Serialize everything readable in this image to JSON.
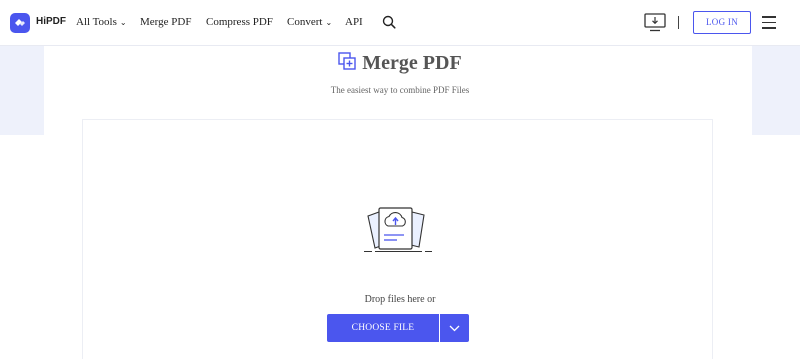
{
  "brand": {
    "name": "HiPDF",
    "logo_icon": "hipdf-logo-icon",
    "accent": "#4b56ee"
  },
  "nav": {
    "items": [
      {
        "label": "All Tools",
        "has_caret": true
      },
      {
        "label": "Merge PDF",
        "has_caret": false
      },
      {
        "label": "Compress PDF",
        "has_caret": false
      },
      {
        "label": "Convert",
        "has_caret": true
      },
      {
        "label": "API",
        "has_caret": false
      }
    ],
    "caret_glyph": "⌄",
    "search_icon": "search-icon",
    "download_icon": "desktop-download-icon",
    "login_label": "LOG IN",
    "menu_icon": "hamburger-menu-icon"
  },
  "hero": {
    "title": "Merge PDF",
    "title_icon": "merge-pdf-icon",
    "subtitle": "The easiest way to combine PDF Files"
  },
  "upload": {
    "illustration_icon": "upload-files-icon",
    "drop_text": "Drop files here or",
    "choose_label": "CHOOSE FILE",
    "dropdown_icon": "chevron-down-icon"
  },
  "colors": {
    "band_bg": "#eef1fb",
    "button_bg": "#4b56ee"
  }
}
